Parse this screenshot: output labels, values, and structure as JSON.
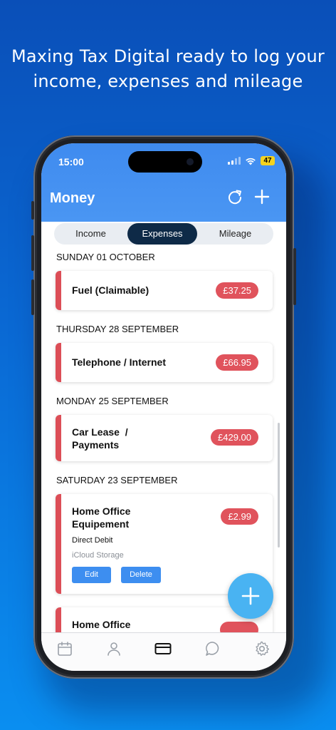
{
  "headline": {
    "line1": "Maxing Tax Digital ready to log your",
    "line2": "income, expenses and mileage"
  },
  "status_bar": {
    "time": "15:00",
    "battery": "47"
  },
  "header": {
    "title": "Money",
    "refresh_icon": "refresh-icon",
    "add_icon": "plus-icon"
  },
  "tabs": [
    {
      "label": "Income",
      "active": false
    },
    {
      "label": "Expenses",
      "active": true
    },
    {
      "label": "Mileage",
      "active": false
    }
  ],
  "entries": [
    {
      "date": "SUNDAY 01 OCTOBER",
      "title": "Fuel (Claimable)",
      "amount": "£37.25"
    },
    {
      "date": "THURSDAY 28 SEPTEMBER",
      "title": "Telephone / Internet",
      "amount": "£66.95"
    },
    {
      "date": "MONDAY 25 SEPTEMBER",
      "title_line1": "Car Lease  /",
      "title_line2": "Payments",
      "amount": "£429.00"
    },
    {
      "date": "SATURDAY 23 SEPTEMBER",
      "title_line1": "Home Office",
      "title_line2": "Equipement",
      "amount": "£2.99",
      "payment_method": "Direct Debit",
      "note": "iCloud Storage",
      "edit_label": "Edit",
      "delete_label": "Delete"
    },
    {
      "title_line1": "Home Office"
    }
  ],
  "bottom_nav": [
    {
      "icon": "calendar-icon",
      "active": false
    },
    {
      "icon": "person-icon",
      "active": false
    },
    {
      "icon": "card-icon",
      "active": true
    },
    {
      "icon": "chat-icon",
      "active": false
    },
    {
      "icon": "gear-icon",
      "active": false
    }
  ],
  "colors": {
    "header_blue": "#3f8bef",
    "active_tab": "#0e2a47",
    "expense_red": "#e0535c",
    "button_blue": "#3d8ef0",
    "fab_blue": "#49b3f2"
  }
}
